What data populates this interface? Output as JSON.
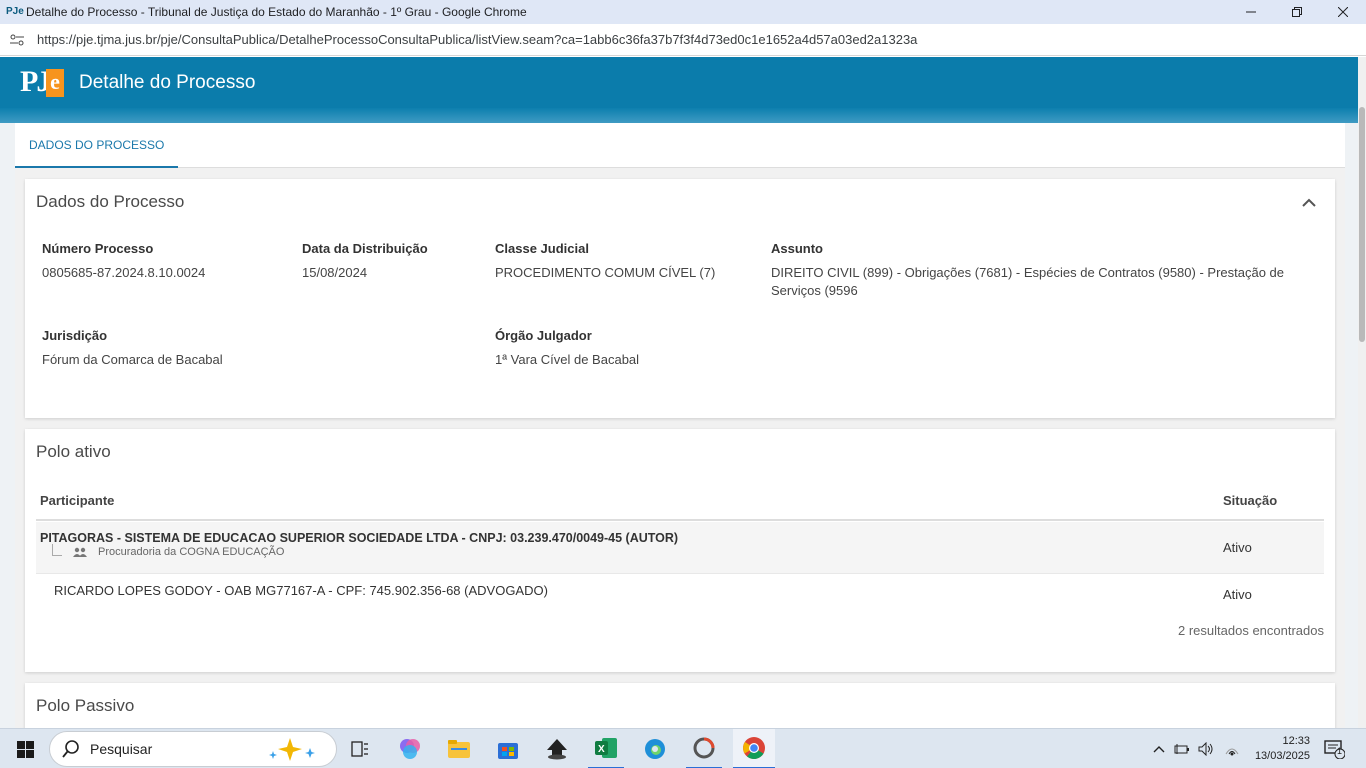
{
  "window": {
    "title": "Detalhe do Processo - Tribunal de Justiça do Estado do Maranhão - 1º Grau - Google Chrome",
    "favicon_text": "PJe",
    "url": "https://pje.tjma.jus.br/pje/ConsultaPublica/DetalheProcessoConsultaPublica/listView.seam?ca=1abb6c36fa37b7f3f4d73ed0c1e1652a4d57a03ed2a1323a"
  },
  "header": {
    "logo_pj": "PJ",
    "logo_e": "e",
    "title": "Detalhe do Processo"
  },
  "tabs": [
    {
      "label": "DADOS DO PROCESSO"
    }
  ],
  "dados_processo": {
    "title": "Dados do Processo",
    "fields": {
      "numero": {
        "label": "Número Processo",
        "value": "0805685-87.2024.8.10.0024"
      },
      "data": {
        "label": "Data da Distribuição",
        "value": "15/08/2024"
      },
      "classe": {
        "label": "Classe Judicial",
        "value": "PROCEDIMENTO COMUM CÍVEL (7)"
      },
      "assunto": {
        "label": "Assunto",
        "value": "DIREITO CIVIL (899) - Obrigações (7681) - Espécies de Contratos (9580) - Prestação de Serviços (9596"
      },
      "jurisdicao": {
        "label": "Jurisdição",
        "value": "Fórum da Comarca de Bacabal"
      },
      "orgao": {
        "label": "Órgão Julgador",
        "value": "1ª Vara Cível de Bacabal"
      }
    }
  },
  "polo_ativo": {
    "title": "Polo ativo",
    "columns": {
      "participante": "Participante",
      "situacao": "Situação"
    },
    "rows": [
      {
        "name": "PITAGORAS - SISTEMA DE EDUCACAO SUPERIOR SOCIEDADE LTDA - CNPJ: 03.239.470/0049-45 (AUTOR)",
        "sub": "Procuradoria da COGNA EDUCAÇÃO",
        "status": "Ativo"
      },
      {
        "name": "RICARDO LOPES GODOY - OAB MG77167-A - CPF: 745.902.356-68 (ADVOGADO)",
        "status": "Ativo"
      }
    ],
    "results": "2 resultados encontrados"
  },
  "polo_passivo": {
    "title": "Polo Passivo"
  },
  "taskbar": {
    "search_placeholder": "Pesquisar",
    "time": "12:33",
    "date": "13/03/2025",
    "notification_count": "1"
  },
  "colors": {
    "header": "#0b7cab",
    "accent": "#1a78ab",
    "logo_orange": "#f7941d"
  }
}
